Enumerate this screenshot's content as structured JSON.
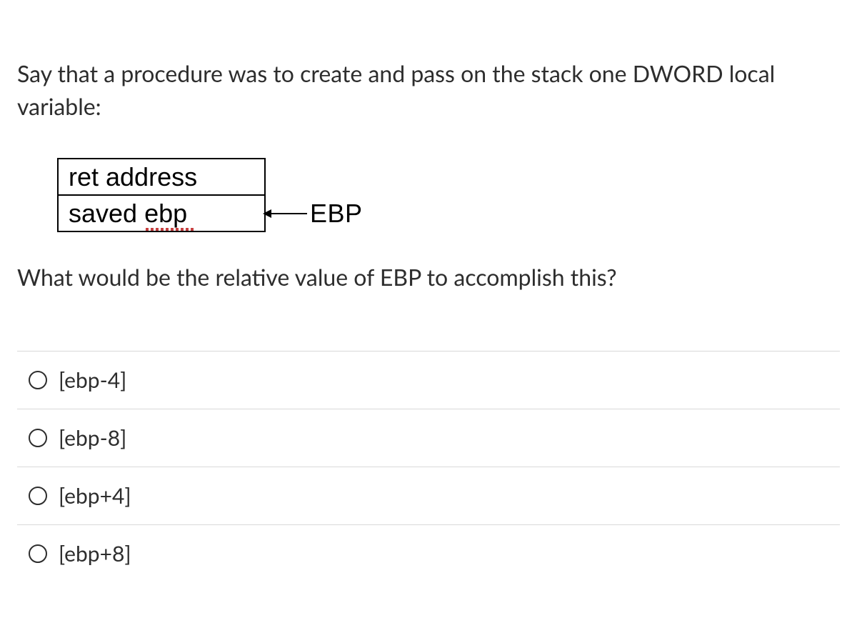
{
  "question": {
    "intro": "Say that a procedure was to create and pass on the stack one DWORD local variable:",
    "followup": "What would be the relative value of EBP to accomplish this?"
  },
  "diagram": {
    "row1": "ret address",
    "row2": "saved ebp",
    "pointer_label": "EBP"
  },
  "options": [
    {
      "label": "[ebp-4]"
    },
    {
      "label": "[ebp-8]"
    },
    {
      "label": "[ebp+4]"
    },
    {
      "label": "[ebp+8]"
    }
  ]
}
